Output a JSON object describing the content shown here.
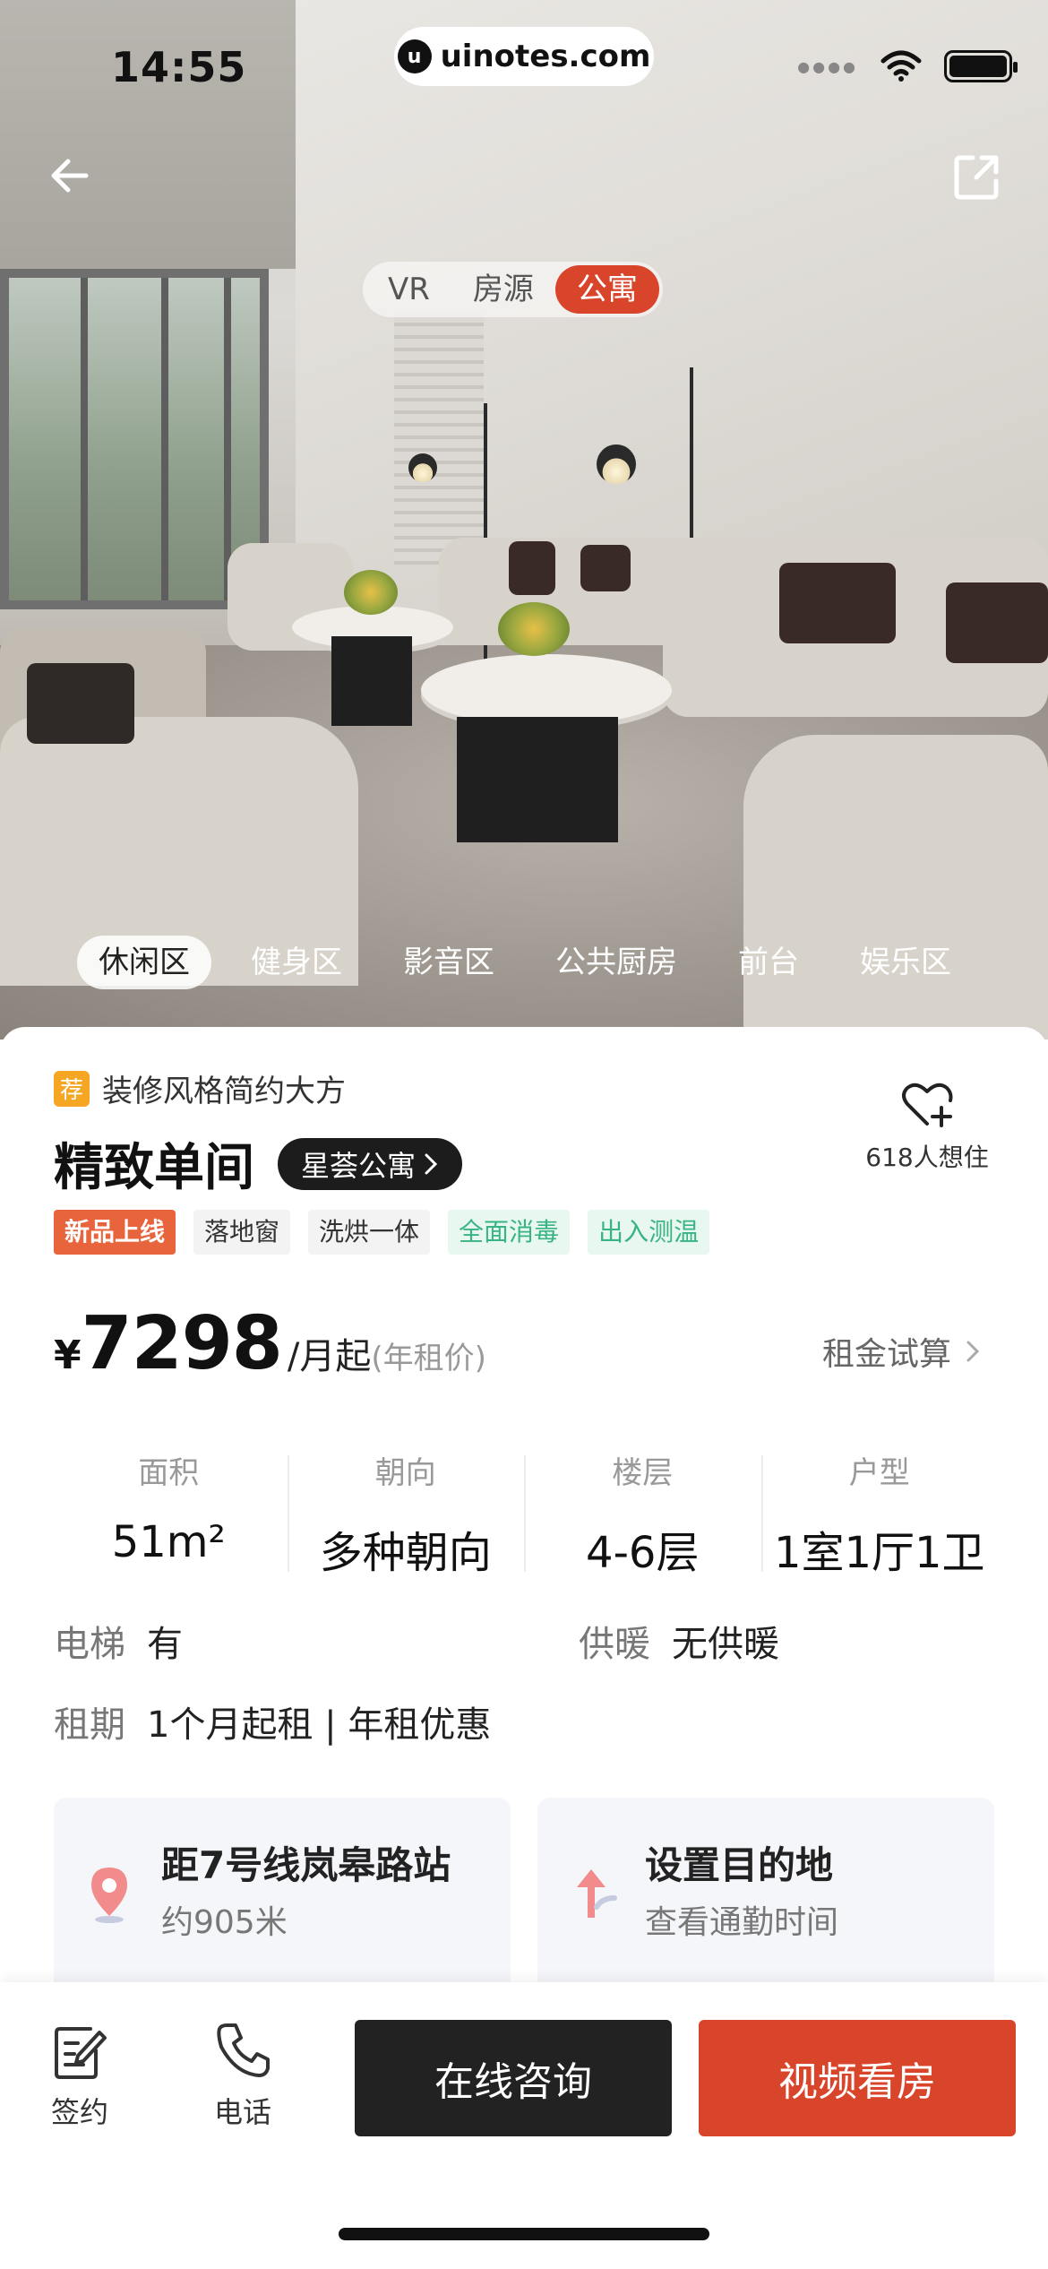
{
  "status_bar": {
    "time": "14:55",
    "url": "uinotes.com",
    "logo_letter": "u"
  },
  "top_tabs": [
    {
      "label": "VR",
      "active": false
    },
    {
      "label": "房源",
      "active": false
    },
    {
      "label": "公寓",
      "active": true
    }
  ],
  "area_tabs": [
    {
      "label": "休闲区",
      "active": true
    },
    {
      "label": "健身区",
      "active": false
    },
    {
      "label": "影音区",
      "active": false
    },
    {
      "label": "公共厨房",
      "active": false
    },
    {
      "label": "前台",
      "active": false
    },
    {
      "label": "娱乐区",
      "active": false
    }
  ],
  "listing": {
    "recommend_badge": "荐",
    "recommend_text": "装修风格简约大方",
    "title": "精致单间",
    "brand": "星荟公寓",
    "want_count": "618人想住",
    "tags": [
      {
        "label": "新品上线",
        "style": "new"
      },
      {
        "label": "落地窗",
        "style": "plain"
      },
      {
        "label": "洗烘一体",
        "style": "plain"
      },
      {
        "label": "全面消毒",
        "style": "green"
      },
      {
        "label": "出入测温",
        "style": "green"
      }
    ],
    "price_symbol": "¥",
    "price": "7298",
    "price_unit": "/月起",
    "price_note": "(年租价)",
    "rent_calc": "租金试算"
  },
  "specs": [
    {
      "label": "面积",
      "value": "51m²"
    },
    {
      "label": "朝向",
      "value": "多种朝向"
    },
    {
      "label": "楼层",
      "value": "4-6层"
    },
    {
      "label": "户型",
      "value": "1室1厅1卫"
    }
  ],
  "attrs": {
    "elevator_label": "电梯",
    "elevator_value": "有",
    "heating_label": "供暖",
    "heating_value": "无供暖",
    "lease_label": "租期",
    "lease_value": "1个月起租 | 年租优惠"
  },
  "poi": {
    "metro_title": "距7号线岚皋路站",
    "metro_sub": "约905米",
    "dest_title": "设置目的地",
    "dest_sub": "查看通勤时间"
  },
  "bottom_bar": {
    "sign_label": "签约",
    "phone_label": "电话",
    "consult_label": "在线咨询",
    "video_label": "视频看房"
  },
  "colors": {
    "accent": "#d9452b",
    "dark_button": "#222222",
    "green_tag": "#38b483",
    "badge_orange": "#f5a623"
  }
}
